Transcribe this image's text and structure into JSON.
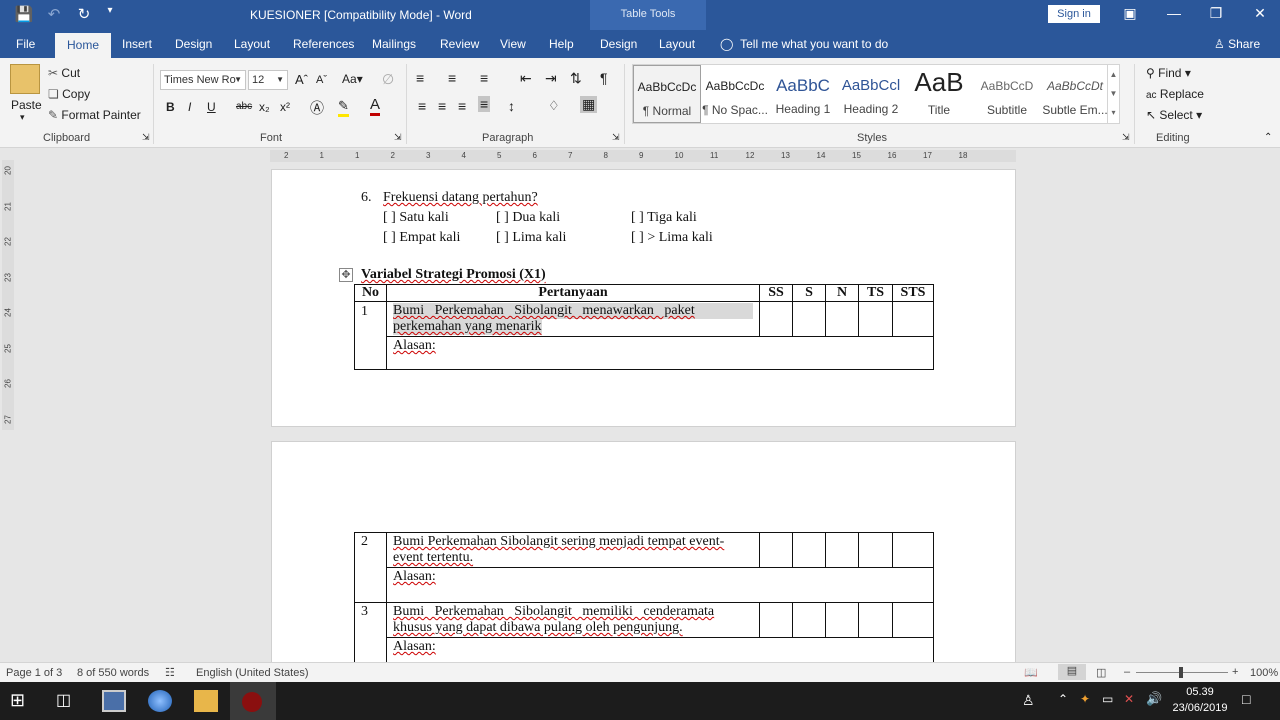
{
  "window": {
    "title": "KUESIONER [Compatibility Mode]  -  Word",
    "context_tab": "Table Tools",
    "sign_in": "Sign in"
  },
  "tabs": [
    "File",
    "Home",
    "Insert",
    "Design",
    "Layout",
    "References",
    "Mailings",
    "Review",
    "View",
    "Help",
    "Design",
    "Layout"
  ],
  "tell_me": "Tell me what you want to do",
  "share": "Share",
  "clipboard": {
    "paste": "Paste",
    "cut": "Cut",
    "copy": "Copy",
    "format_painter": "Format Painter",
    "label": "Clipboard"
  },
  "font": {
    "name": "Times New Ro",
    "size": "12",
    "case": "Aa",
    "label": "Font",
    "bold": "B",
    "italic": "I",
    "underline": "U",
    "strike": "abc",
    "sub": "x₂",
    "sup": "x²"
  },
  "paragraph": {
    "label": "Paragraph"
  },
  "styles": {
    "label": "Styles",
    "items": [
      {
        "preview": "AaBbCcDc",
        "name": "¶ Normal"
      },
      {
        "preview": "AaBbCcDc",
        "name": "¶ No Spac..."
      },
      {
        "preview": "AaBbC",
        "name": "Heading 1"
      },
      {
        "preview": "AaBbCcl",
        "name": "Heading 2"
      },
      {
        "preview": "AaB",
        "name": "Title"
      },
      {
        "preview": "AaBbCcD",
        "name": "Subtitle"
      },
      {
        "preview": "AaBbCcDt",
        "name": "Subtle Em..."
      }
    ]
  },
  "editing": {
    "find": "Find",
    "replace": "Replace",
    "select": "Select",
    "label": "Editing"
  },
  "ruler": {
    "ticks": [
      "2",
      "1",
      "1",
      "2",
      "3",
      "4",
      "5",
      "6",
      "7",
      "8",
      "9",
      "10",
      "11",
      "12",
      "13",
      "14",
      "15",
      "16",
      "17",
      "18"
    ],
    "vticks": [
      "20",
      "21",
      "22",
      "23",
      "24",
      "25",
      "26",
      "27"
    ]
  },
  "document": {
    "q6": {
      "number": "6.",
      "text": "Frekuensi datang pertahun?",
      "options": [
        [
          "[  ] Satu kali",
          "[  ] Dua kali",
          "[  ] Tiga kali"
        ],
        [
          "[  ] Empat kali",
          "[  ] Lima kali",
          "[  ] > Lima kali"
        ]
      ]
    },
    "section_title": "Variabel Strategi Promosi (X1)",
    "headers": [
      "No",
      "Pertanyaan",
      "SS",
      "S",
      "N",
      "TS",
      "STS"
    ],
    "alasan": "Alasan:",
    "rows": [
      {
        "no": "1",
        "line1": "Bumi   Perkemahan   Sibolangit   menawarkan   paket",
        "line2": "perkemahan yang menarik"
      },
      {
        "no": "2",
        "line1": "Bumi Perkemahan Sibolangit sering menjadi tempat event-",
        "line2": "event tertentu."
      },
      {
        "no": "3",
        "line1": "Bumi   Perkemahan   Sibolangit   memiliki   cenderamata",
        "line2": "khusus yang dapat dibawa pulang oleh pengunjung."
      }
    ]
  },
  "status": {
    "page": "Page 1 of 3",
    "words": "8 of 550 words",
    "language": "English (United States)",
    "zoom": "100%"
  },
  "taskbar": {
    "time": "05.39",
    "date": "23/06/2019"
  }
}
